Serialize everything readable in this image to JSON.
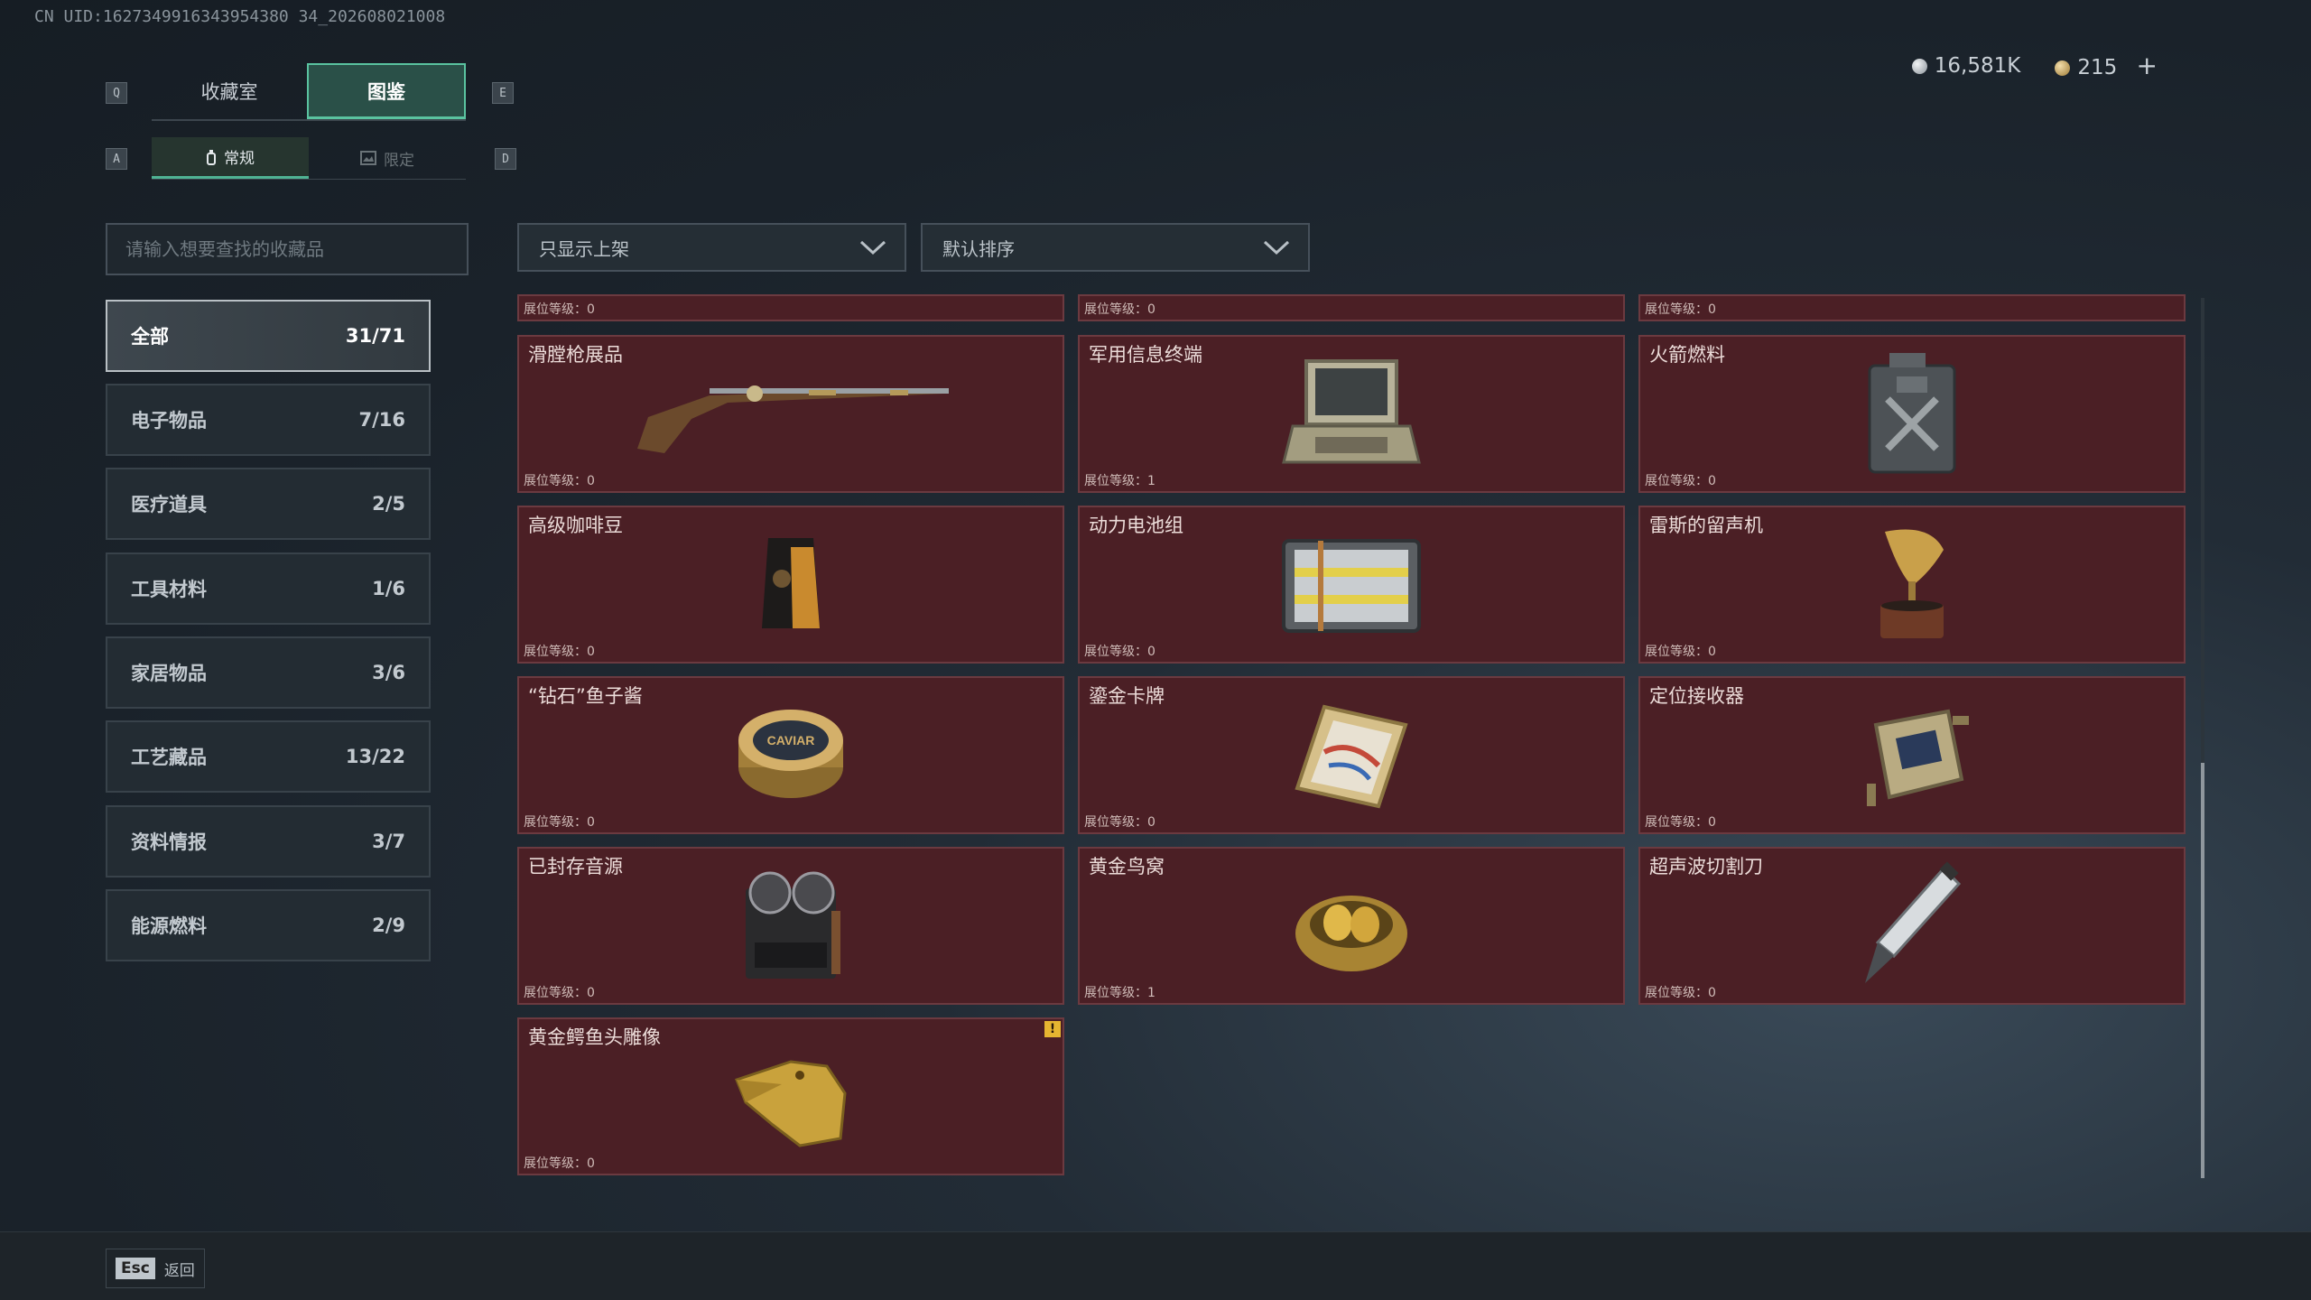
{
  "uid": "CN UID:1627349916343954380 34_202608021008",
  "header": {
    "tabs": [
      "收藏室",
      "图鉴"
    ],
    "active_tab": 1,
    "key_left": "Q",
    "key_right": "E",
    "subtabs": [
      "常规",
      "限定"
    ],
    "sub_key_left": "A",
    "sub_key_right": "D",
    "currency_silver": "16,581K",
    "currency_gold": "215",
    "currency_add": "+"
  },
  "search": {
    "placeholder": "请输入想要查找的收藏品"
  },
  "filters": {
    "shelf": "只显示上架",
    "sort": "默认排序"
  },
  "categories": [
    {
      "label": "全部",
      "count": "31/71"
    },
    {
      "label": "电子物品",
      "count": "7/16"
    },
    {
      "label": "医疗道具",
      "count": "2/5"
    },
    {
      "label": "工具材料",
      "count": "1/6"
    },
    {
      "label": "家居物品",
      "count": "3/6"
    },
    {
      "label": "工艺藏品",
      "count": "13/22"
    },
    {
      "label": "资料情报",
      "count": "3/7"
    },
    {
      "label": "能源燃料",
      "count": "2/9"
    }
  ],
  "partial_row": [
    "展位等级：0",
    "展位等级：0",
    "展位等级：0"
  ],
  "items": [
    {
      "name": "滑膛枪展品",
      "level": "展位等级：0",
      "icon": "musket-icon"
    },
    {
      "name": "军用信息终端",
      "level": "展位等级：1",
      "icon": "military-terminal-icon"
    },
    {
      "name": "火箭燃料",
      "level": "展位等级：0",
      "icon": "fuel-canister-icon"
    },
    {
      "name": "高级咖啡豆",
      "level": "展位等级：0",
      "icon": "coffee-bag-icon"
    },
    {
      "name": "动力电池组",
      "level": "展位等级：0",
      "icon": "battery-pack-icon"
    },
    {
      "name": "雷斯的留声机",
      "level": "展位等级：0",
      "icon": "gramophone-icon"
    },
    {
      "name": "“钻石”鱼子酱",
      "level": "展位等级：0",
      "icon": "caviar-tin-icon",
      "icon_text": "CAVIAR"
    },
    {
      "name": "鎏金卡牌",
      "level": "展位等级：0",
      "icon": "gilded-card-icon"
    },
    {
      "name": "定位接收器",
      "level": "展位等级：0",
      "icon": "locator-receiver-icon"
    },
    {
      "name": "已封存音源",
      "level": "展位等级：0",
      "icon": "reel-recorder-icon"
    },
    {
      "name": "黄金鸟窝",
      "level": "展位等级：1",
      "icon": "golden-nest-icon"
    },
    {
      "name": "超声波切割刀",
      "level": "展位等级：0",
      "icon": "ultrasonic-knife-icon"
    },
    {
      "name": "黄金鳄鱼头雕像",
      "level": "展位等级：0",
      "icon": "golden-crocodile-icon",
      "warning": "!"
    }
  ],
  "footer": {
    "key": "Esc",
    "label": "返回"
  }
}
